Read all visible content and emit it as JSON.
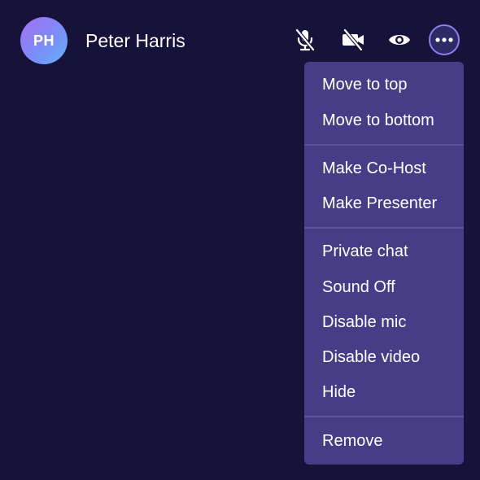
{
  "participant": {
    "initials": "PH",
    "name": "Peter Harris"
  },
  "controls": {
    "mic_icon": "mic-off-icon",
    "camera_icon": "video-off-icon",
    "visibility_icon": "eye-icon",
    "more_icon": "more-options-icon"
  },
  "menu": {
    "groups": [
      [
        "Move to top",
        "Move to bottom"
      ],
      [
        "Make Co-Host",
        "Make Presenter"
      ],
      [
        "Private chat",
        "Sound Off",
        "Disable mic",
        "Disable video",
        "Hide"
      ],
      [
        "Remove"
      ]
    ]
  },
  "colors": {
    "background": "#16123a",
    "menu_background": "#453e86",
    "accent_ring": "#8c7ff0",
    "text": "#ffffff"
  }
}
